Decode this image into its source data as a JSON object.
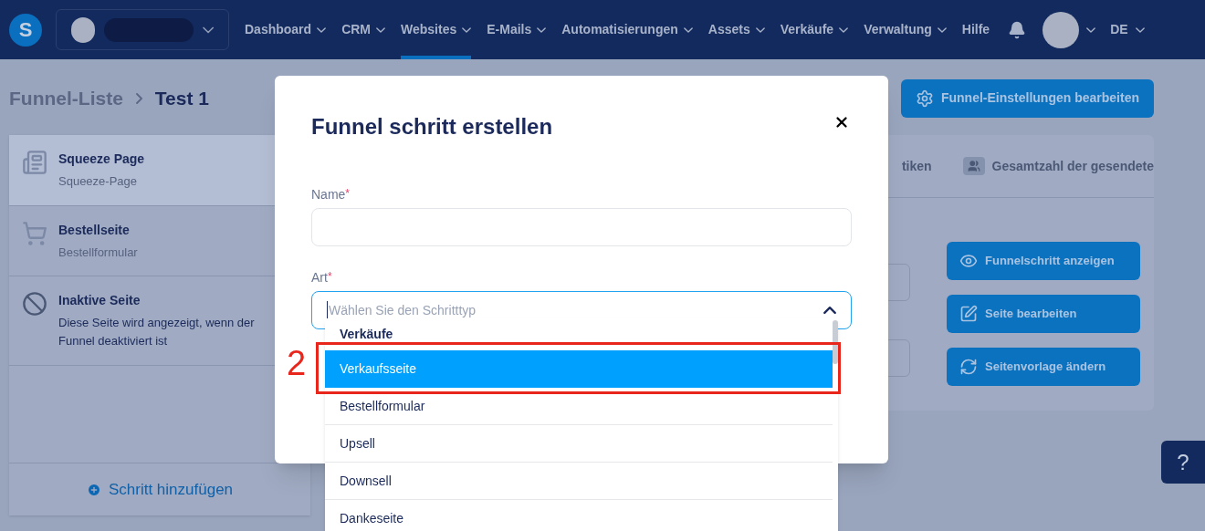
{
  "header": {
    "nav": [
      {
        "label": "Dashboard",
        "has_menu": true,
        "selected": false
      },
      {
        "label": "CRM",
        "has_menu": true,
        "selected": false
      },
      {
        "label": "Websites",
        "has_menu": true,
        "selected": true
      },
      {
        "label": "E-Mails",
        "has_menu": true,
        "selected": false
      },
      {
        "label": "Automatisierungen",
        "has_menu": true,
        "selected": false
      },
      {
        "label": "Assets",
        "has_menu": true,
        "selected": false
      },
      {
        "label": "Verkäufe",
        "has_menu": true,
        "selected": false
      },
      {
        "label": "Verwaltung",
        "has_menu": true,
        "selected": false
      },
      {
        "label": "Hilfe",
        "has_menu": false,
        "selected": false
      }
    ],
    "logo": "S",
    "language": "DE"
  },
  "breadcrumb": {
    "parent": "Funnel-Liste",
    "current": "Test 1"
  },
  "settings_button": "Funnel-Einstellungen bearbeiten",
  "steps": [
    {
      "kind": "page",
      "title": "Squeeze Page",
      "subtitle": "Squeeze-Page",
      "selected": true
    },
    {
      "kind": "cart",
      "title": "Bestellseite",
      "subtitle": "Bestellformular",
      "selected": false
    },
    {
      "kind": "inactive",
      "title": "Inaktive Seite",
      "subtitle": "Diese Seite wird angezeigt, wenn der Funnel deaktiviert ist",
      "selected": false
    }
  ],
  "add_step": "Schritt hinzufügen",
  "tabs": [
    {
      "kind": "plain",
      "label": "tiken"
    },
    {
      "kind": "people",
      "label": "Gesamtzahl der gesendete"
    }
  ],
  "actions": [
    {
      "kind": "view",
      "label": "Funnelschritt anzeigen"
    },
    {
      "kind": "edit",
      "label": "Seite bearbeiten"
    },
    {
      "kind": "swap",
      "label": "Seitenvorlage ändern"
    }
  ],
  "help_button": "?",
  "modal": {
    "title": "Funnel schritt erstellen",
    "name_field": {
      "label": "Name",
      "required_mark": "*"
    },
    "type_field": {
      "label": "Art",
      "required_mark": "*",
      "placeholder": "Wählen Sie den Schritttyp",
      "expanded": true
    },
    "dropdown": {
      "group": "Verkäufe",
      "options": [
        {
          "label": "Verkaufsseite",
          "selected": true
        },
        {
          "label": "Bestellformular",
          "selected": false
        },
        {
          "label": "Upsell",
          "selected": false
        },
        {
          "label": "Downsell",
          "selected": false
        },
        {
          "label": "Dankeseite",
          "selected": false
        }
      ]
    }
  },
  "annotation": {
    "number": "2"
  }
}
